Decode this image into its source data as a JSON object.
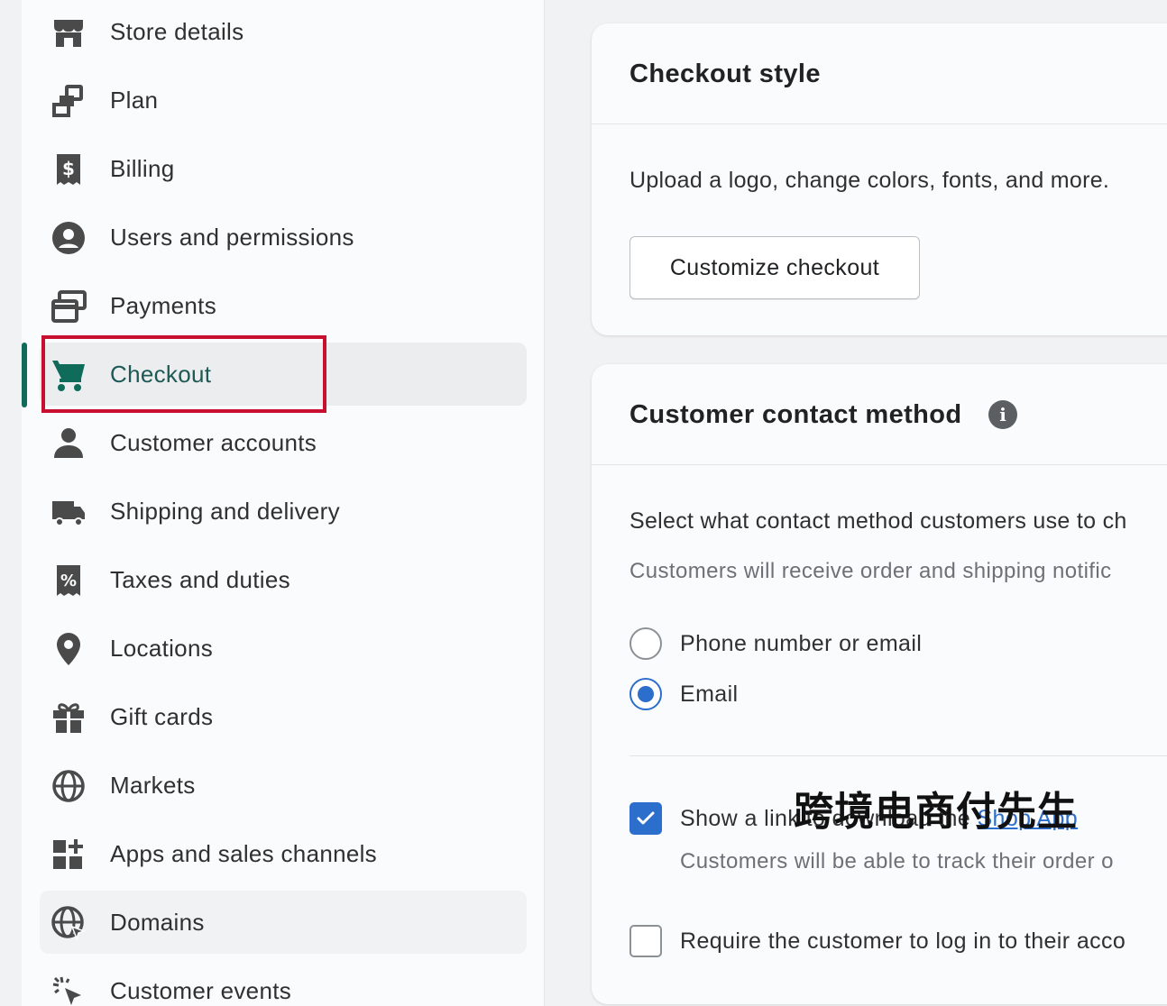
{
  "sidebar": {
    "items": [
      {
        "label": "Store details",
        "icon": "store-icon"
      },
      {
        "label": "Plan",
        "icon": "plan-icon"
      },
      {
        "label": "Billing",
        "icon": "billing-icon"
      },
      {
        "label": "Users and permissions",
        "icon": "user-circle-icon"
      },
      {
        "label": "Payments",
        "icon": "payments-icon"
      },
      {
        "label": "Checkout",
        "icon": "cart-icon",
        "active": true
      },
      {
        "label": "Customer accounts",
        "icon": "customer-icon"
      },
      {
        "label": "Shipping and delivery",
        "icon": "truck-icon"
      },
      {
        "label": "Taxes and duties",
        "icon": "tax-icon"
      },
      {
        "label": "Locations",
        "icon": "location-pin-icon"
      },
      {
        "label": "Gift cards",
        "icon": "gift-icon"
      },
      {
        "label": "Markets",
        "icon": "globe-icon"
      },
      {
        "label": "Apps and sales channels",
        "icon": "apps-icon"
      },
      {
        "label": "Domains",
        "icon": "domain-globe-icon"
      },
      {
        "label": "Customer events",
        "icon": "cursor-click-icon"
      }
    ]
  },
  "checkout_style": {
    "title": "Checkout style",
    "description": "Upload a logo, change colors, fonts, and more.",
    "button_label": "Customize checkout"
  },
  "contact_method": {
    "title": "Customer contact method",
    "description": "Select what contact method customers use to ch",
    "note": "Customers will receive order and shipping notific",
    "options": [
      {
        "label": "Phone number or email",
        "checked": false
      },
      {
        "label": "Email",
        "checked": true
      }
    ],
    "shop_app": {
      "label_prefix": "Show a link to download the ",
      "link_text": "Shop App",
      "checked": true,
      "note": "Customers will be able to track their order o"
    },
    "require_login": {
      "label": "Require the customer to log in to their acco",
      "checked": false
    }
  },
  "watermark": "跨境电商付先生",
  "colors": {
    "accent": "#2c6ecb",
    "active_green": "#0f6b5a",
    "highlight_red": "#c8102e"
  }
}
